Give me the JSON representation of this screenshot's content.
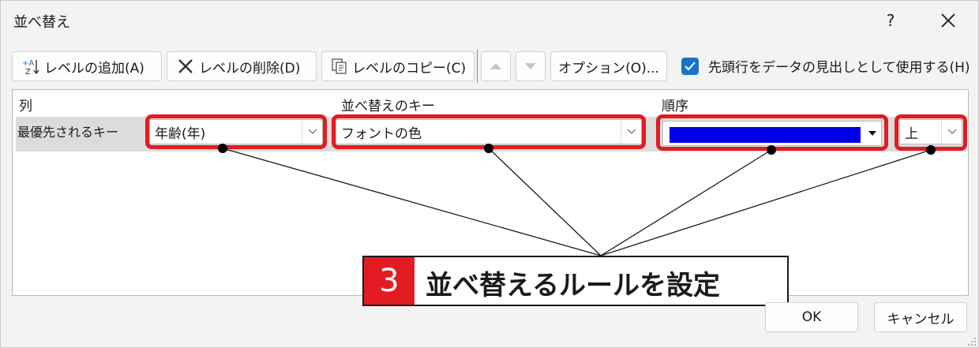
{
  "dialog": {
    "title": "並べ替え",
    "help_label": "?"
  },
  "toolbar": {
    "add_level": "レベルの追加(A)",
    "delete_level": "レベルの削除(D)",
    "copy_level": "レベルのコピー(C)",
    "options": "オプション(O)...",
    "header_checkbox_label": "先頭行をデータの見出しとして使用する(H)",
    "header_checkbox_checked": true
  },
  "table": {
    "headers": {
      "column": "列",
      "sort_key": "並べ替えのキー",
      "order": "順序"
    },
    "rows": [
      {
        "label": "最優先されるキー",
        "column_value": "年齢(年)",
        "sort_key_value": "フォントの色",
        "order_color": "#0000e6",
        "order_position": "上"
      }
    ]
  },
  "callout": {
    "number": "3",
    "text": "並べ替えるルールを設定"
  },
  "footer": {
    "ok": "OK",
    "cancel": "キャンセル"
  },
  "colors": {
    "highlight": "#e31b23",
    "checkbox": "#1a73c9",
    "font_color_swatch": "#0000e6"
  },
  "icons": {
    "add_level": "add-level-icon",
    "delete_level": "x-icon",
    "copy_level": "copy-icon",
    "move_up": "triangle-up-icon",
    "move_down": "triangle-down-icon",
    "close": "close-icon",
    "dropdown": "chevron-down-icon"
  }
}
